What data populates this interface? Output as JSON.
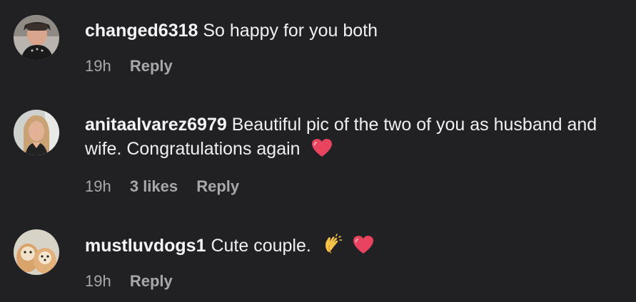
{
  "comments": [
    {
      "username": "changed6318",
      "text": "So happy for you both",
      "time": "19h",
      "likes": "",
      "reply_label": "Reply"
    },
    {
      "username": "anitaalvarez6979",
      "text": "Beautiful pic of the two of you as husband and wife. Congratulations again",
      "time": "19h",
      "likes": "3 likes",
      "reply_label": "Reply",
      "emojis": [
        "heart-icon"
      ]
    },
    {
      "username": "mustluvdogs1",
      "text": "Cute couple.",
      "time": "19h",
      "likes": "",
      "reply_label": "Reply",
      "emojis": [
        "clapping-hands-icon",
        "heart-icon"
      ]
    }
  ],
  "colors": {
    "background": "#212124",
    "text": "#f5f5f5",
    "meta": "#a8a8a8",
    "heart": "#e8435f"
  }
}
